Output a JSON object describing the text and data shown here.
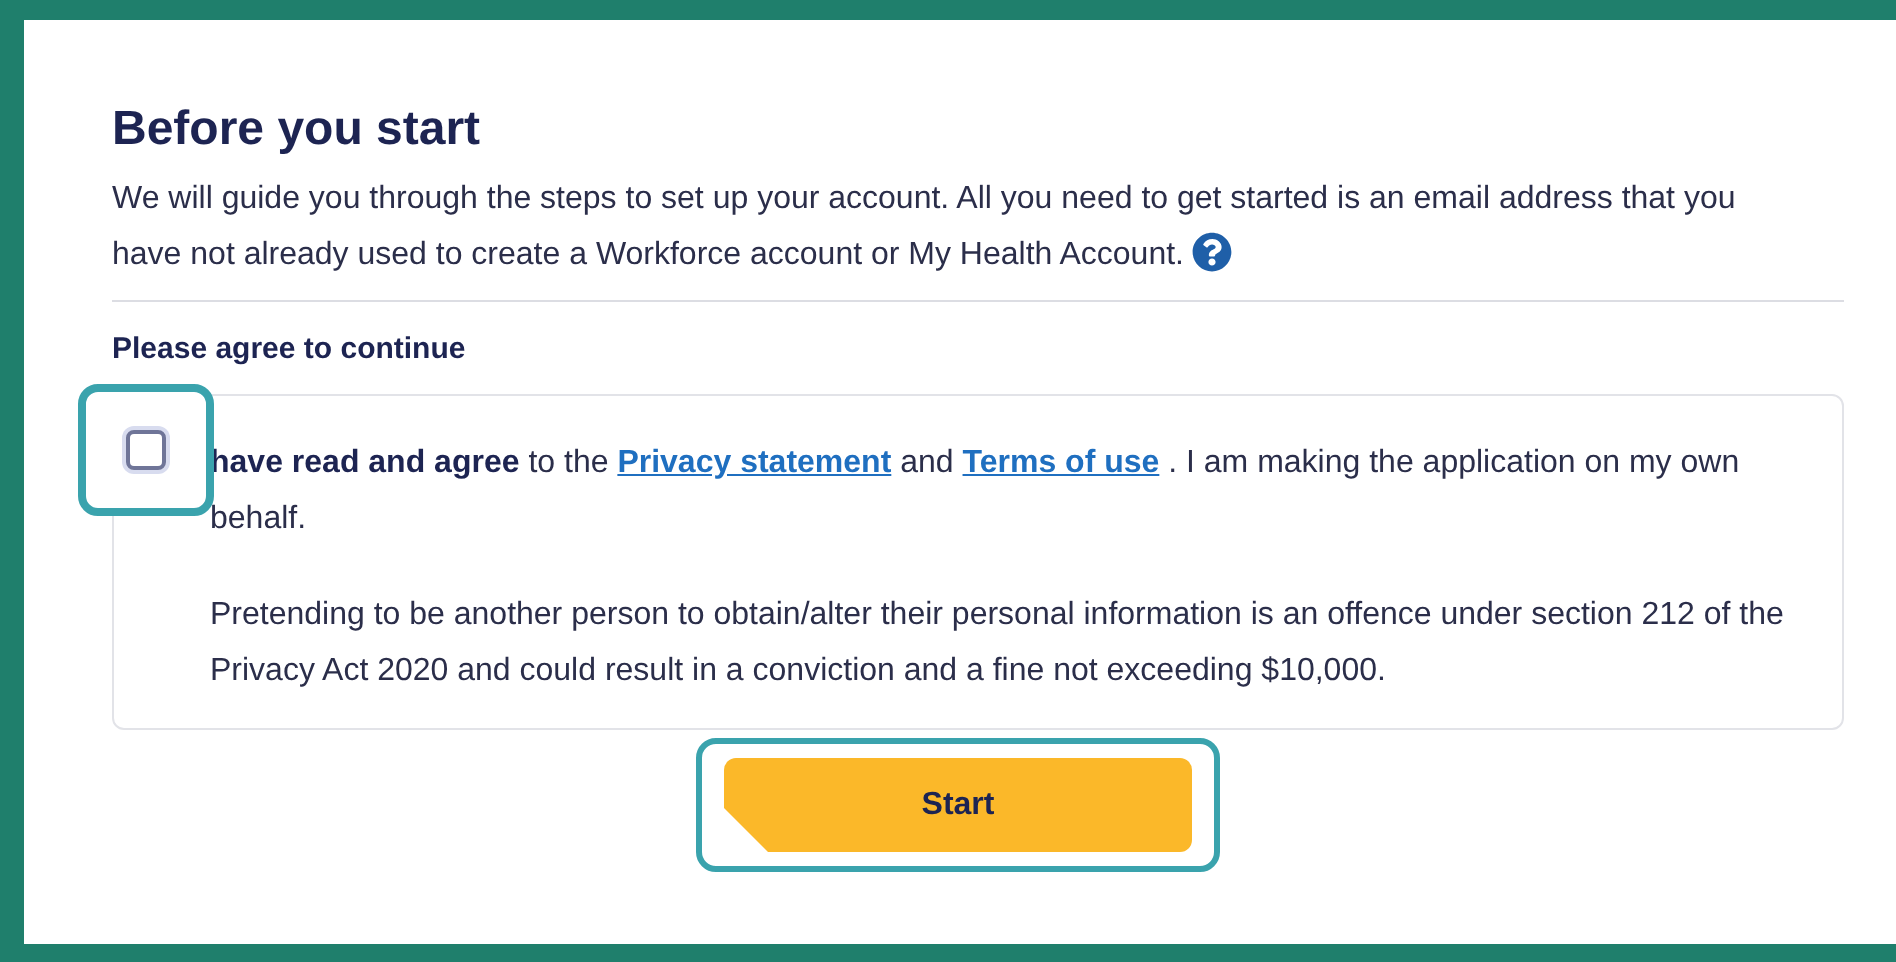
{
  "title": "Before you start",
  "intro": "We will guide you through the steps to set up your account. All you need to get started is an email address that you have not already used to create a Workforce account or My Health Account.",
  "agree_heading": "Please agree to continue",
  "consent": {
    "checked": false,
    "focused": true,
    "lead": "have read and agree",
    "text_1": "to the",
    "link_1": "Privacy statement",
    "text_2": "and",
    "link_2": "Terms of use",
    "text_3": ". I am making the application on my own behalf.",
    "warning": "Pretending to be another person to obtain/alter their personal information is an offence under section 212 of the Privacy Act 2020 and could result in a conviction and a fine not exceeding $10,000."
  },
  "start_button": {
    "label": "Start",
    "focused": true
  }
}
